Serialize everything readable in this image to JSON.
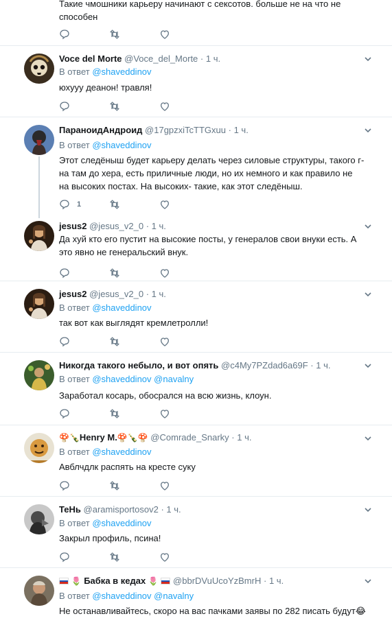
{
  "tweets": [
    {
      "id": "t0",
      "text": "Такие чмошники карьеру начинают с сексотов. больше не на что не способен"
    },
    {
      "id": "t1",
      "name": "Voce del Morte",
      "handle": "@Voce_del_Morte",
      "time": "1 ч.",
      "reply_prefix": "В ответ",
      "mentions": [
        "@shaveddinov"
      ],
      "text": "юхууу деанон! травля!"
    },
    {
      "id": "t2",
      "name": "ПараноидАндроид",
      "handle": "@17gpzxiTcTTGxuu",
      "time": "1 ч.",
      "reply_prefix": "В ответ",
      "mentions": [
        "@shaveddinov"
      ],
      "text": "Этот следёныш будет карьеру делать через силовые структуры, такого г-на там до хера, есть приличные люди, но их немного и как правило не на высоких постах. На высоких- такие, как этот следёныш.",
      "reply_count": "1"
    },
    {
      "id": "t3",
      "name": "jesus2",
      "handle": "@jesus_v2_0",
      "time": "1 ч.",
      "text": "Да хуй кто его пустит на высокие посты, у генералов свои внуки есть. А это явно не генеральский внук."
    },
    {
      "id": "t4",
      "name": "jesus2",
      "handle": "@jesus_v2_0",
      "time": "1 ч.",
      "reply_prefix": "В ответ",
      "mentions": [
        "@shaveddinov"
      ],
      "text": "так вот как выглядят кремлетролли!"
    },
    {
      "id": "t5",
      "name": "Никогда такого небыло, и вот опять",
      "handle": "@c4My7PZdad6a69F",
      "time": "1 ч.",
      "reply_prefix": "В ответ",
      "mentions": [
        "@shaveddinov",
        "@navalny"
      ],
      "text": "Заработал косарь, обосрался на всю жизнь, клоун."
    },
    {
      "id": "t6",
      "name": "Henry M.",
      "handle": "@Comrade_Snarky",
      "time": "1 ч.",
      "reply_prefix": "В ответ",
      "mentions": [
        "@shaveddinov"
      ],
      "text": "Авблчдлк распять на кресте суку"
    },
    {
      "id": "t7",
      "name": "ТеНь",
      "handle": "@aramisportosov2",
      "time": "1 ч.",
      "reply_prefix": "В ответ",
      "mentions": [
        "@shaveddinov"
      ],
      "text": "Закрыл профиль, псина!"
    },
    {
      "id": "t8",
      "name": "Бабка в кедах",
      "handle": "@bbrDVuUcoYzBmrH",
      "time": "1 ч.",
      "reply_prefix": "В ответ",
      "mentions": [
        "@shaveddinov",
        "@navalny"
      ],
      "text": "Не останавливайтесь, скоро на вас пачками заявы по 282 писать будут😂"
    }
  ],
  "separator": "·",
  "icons": {
    "reply": "reply-icon",
    "retweet": "retweet-icon",
    "like": "like-icon",
    "caret": "chevron-down-icon"
  },
  "colors": {
    "link": "#1da1f2",
    "muted": "#657786",
    "text": "#14171a",
    "border": "#e6ecf0",
    "thread": "#ccd6dd"
  }
}
